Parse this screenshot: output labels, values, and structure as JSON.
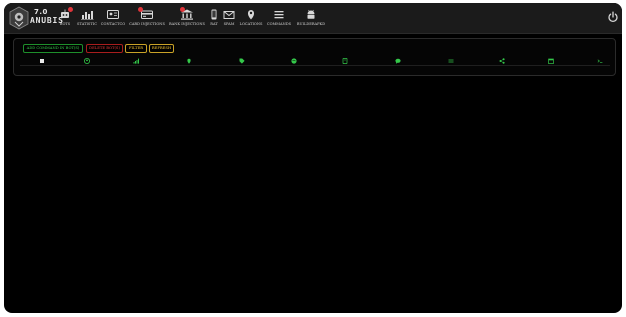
{
  "brand": {
    "version": "7.0",
    "name": "ANUBIS"
  },
  "nav": {
    "items": [
      {
        "label": "BOTS",
        "icon": "bot-icon",
        "badge": true
      },
      {
        "label": "STATISTIC",
        "icon": "bar-chart-icon",
        "badge": false
      },
      {
        "label": "CONTACTCO",
        "icon": "contact-card-icon",
        "badge": false
      },
      {
        "label": "CARD INJECTIONS",
        "icon": "credit-card-icon",
        "badge": true
      },
      {
        "label": "BANK INJECTIONS",
        "icon": "bank-icon",
        "badge": true
      },
      {
        "label": "RAT",
        "icon": "phone-icon",
        "badge": false
      },
      {
        "label": "SPAM",
        "icon": "envelope-icon",
        "badge": false
      },
      {
        "label": "LOCATIONS",
        "icon": "map-pin-icon",
        "badge": false
      },
      {
        "label": "COMMANDS",
        "icon": "list-icon",
        "badge": false
      },
      {
        "label": "BUILDERAPKD",
        "icon": "android-icon",
        "badge": false
      }
    ]
  },
  "toolbar": {
    "add_label": "ADD COMMAND IN BOT(S)",
    "delete_label": "DELETE BOT(S)",
    "filter_label": "FILTER",
    "refresh_label": "REFRESH"
  },
  "columns": [
    {
      "icon": "user-circle-icon"
    },
    {
      "icon": "signal-icon"
    },
    {
      "icon": "map-marker-icon"
    },
    {
      "icon": "tag-icon"
    },
    {
      "icon": "globe-icon"
    },
    {
      "icon": "mobile-icon"
    },
    {
      "icon": "chat-icon"
    },
    {
      "icon": "exchange-icon"
    },
    {
      "icon": "share-icon"
    },
    {
      "icon": "calendar-icon"
    },
    {
      "icon": "terminal-icon"
    }
  ],
  "colors": {
    "accent_green": "#34c84a",
    "danger_red": "#e23a3a",
    "warning_yellow": "#f2c230",
    "badge_red": "#e0343a",
    "background": "#000000"
  }
}
